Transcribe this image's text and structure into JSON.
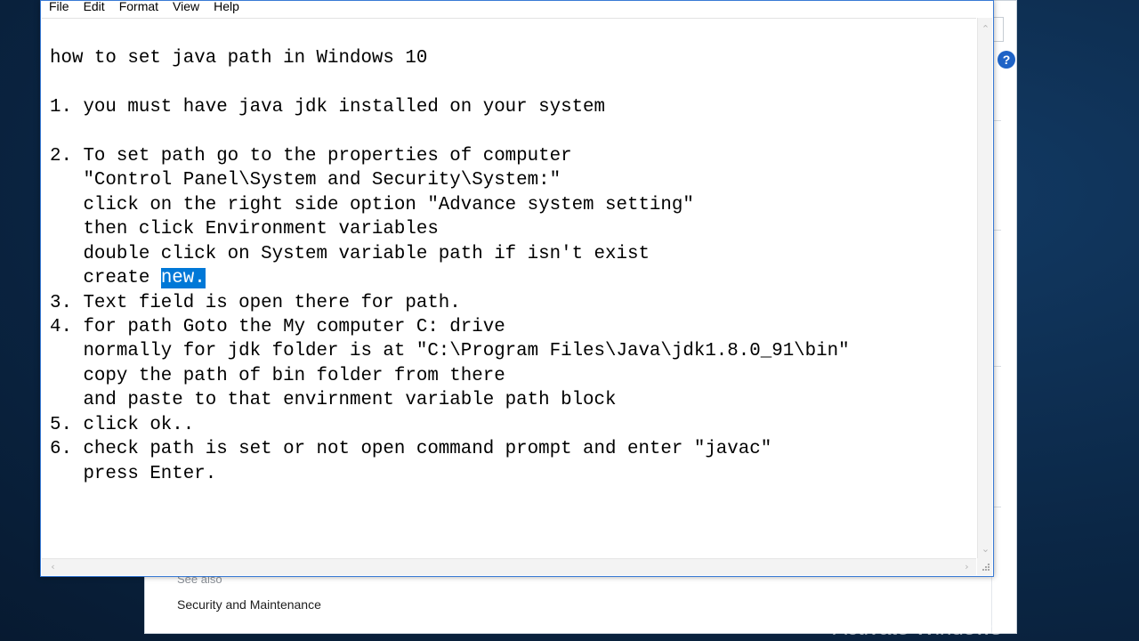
{
  "notepad": {
    "menu": [
      "File",
      "Edit",
      "Format",
      "View",
      "Help"
    ],
    "text_before_selection": "how to set java path in Windows 10\n\n1. you must have java jdk installed on your system\n\n2. To set path go to the properties of computer\n   \"Control Panel\\System and Security\\System:\"\n   click on the right side option \"Advance system setting\"\n   then click Environment variables\n   double click on System variable path if isn't exist\n   create ",
    "selected_text": "new.",
    "text_after_selection": "\n3. Text field is open there for path.\n4. for path Goto the My computer C: drive\n   normally for jdk folder is at \"C:\\Program Files\\Java\\jdk1.8.0_91\\bin\"\n   copy the path of bin folder from there\n   and paste to that envirnment variable path block\n5. click ok..\n6. check path is set or not open command prompt and enter \"javac\"\n   press Enter.",
    "selection_color": "#0078d7"
  },
  "control_panel": {
    "see_also": "See also",
    "link_security": "Security and Maintenance",
    "help_icon": "?"
  },
  "desktop": {
    "watermark": "Activate Windows"
  }
}
